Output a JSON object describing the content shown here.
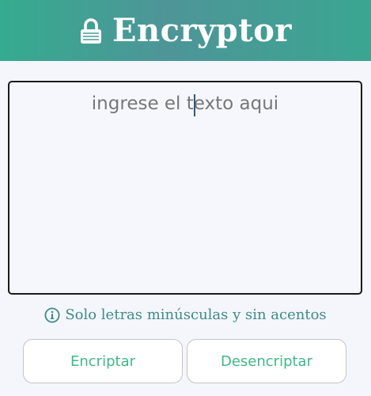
{
  "header": {
    "icon": "lock-icon",
    "title": "Encryptor",
    "gradient": [
      "#35ab8f",
      "#4e9598",
      "#3aa691"
    ]
  },
  "input": {
    "placeholder": "ingrese el texto aqui",
    "value": ""
  },
  "hint": {
    "icon": "info-icon",
    "text": "Solo letras minúsculas y sin acentos",
    "color": "#3e8b8a"
  },
  "buttons": {
    "encrypt_label": "Encriptar",
    "decrypt_label": "Desencriptar",
    "text_color": "#3fb887"
  }
}
